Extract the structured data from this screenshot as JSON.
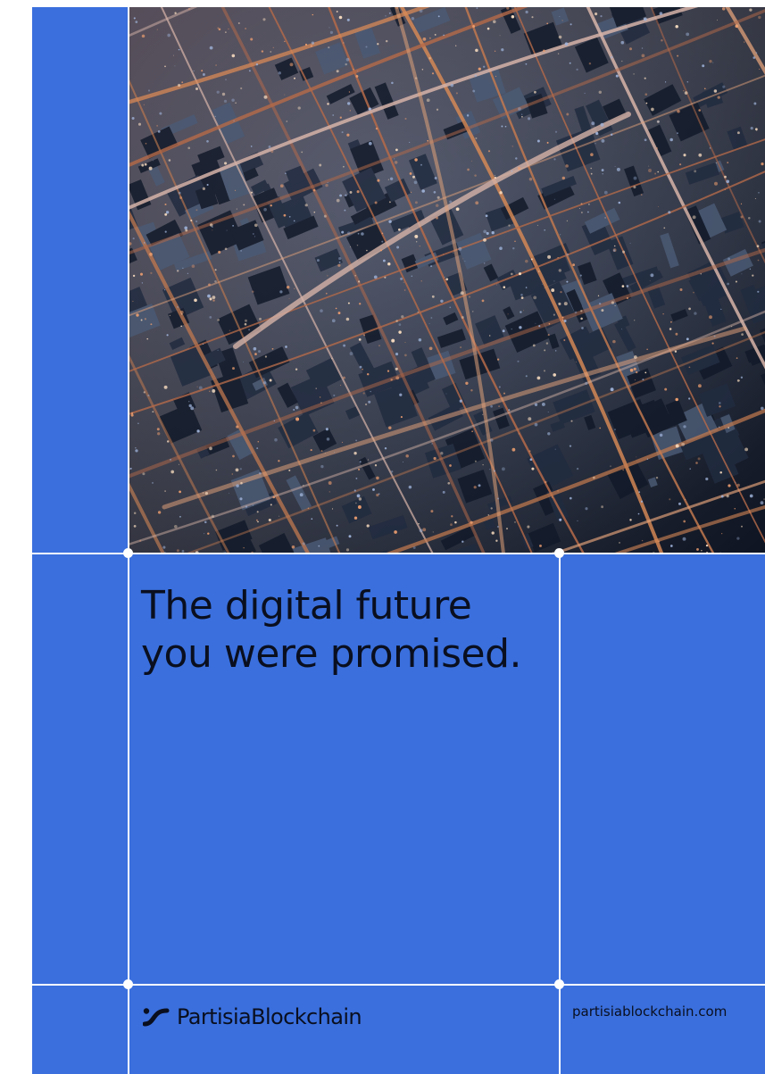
{
  "headline": {
    "line1": "The digital future",
    "line2": "you were promised."
  },
  "footer": {
    "brand_name": "PartisiaBlockchain",
    "website": "partisiablockchain.com"
  },
  "photo": {
    "subject": "aerial-night-city-photo"
  },
  "icons": {
    "brand": "partisia-logo-icon"
  },
  "colors": {
    "background": "#3a6fdd",
    "grid_lines": "#ffffff",
    "text": "#0a0f1f"
  }
}
